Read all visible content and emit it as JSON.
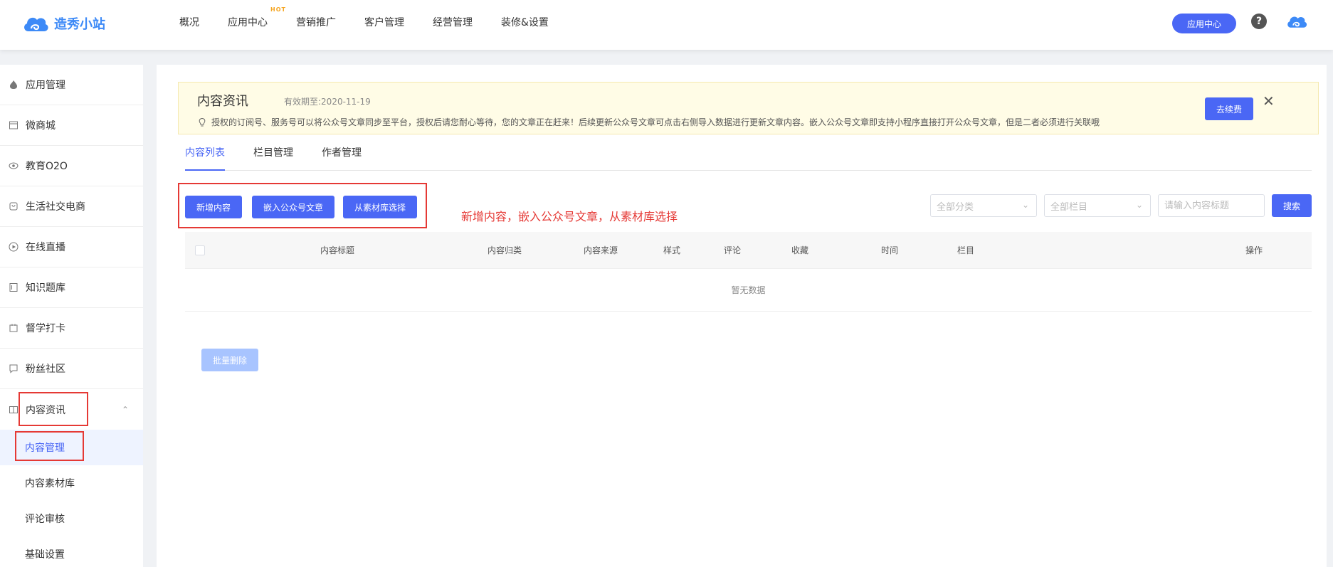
{
  "brand": {
    "name": "造秀小站",
    "color": "#3d8af7"
  },
  "nav": {
    "items": [
      "概况",
      "应用中心",
      "营销推广",
      "客户管理",
      "经营管理",
      "装修&设置"
    ],
    "hot_badge": "HOT",
    "app_center_button": "应用中心",
    "help": "?"
  },
  "sidebar": {
    "items": [
      {
        "label": "应用管理",
        "icon": "flame-icon"
      },
      {
        "label": "微商城",
        "icon": "store-icon"
      },
      {
        "label": "教育O2O",
        "icon": "eye-icon"
      },
      {
        "label": "生活社交电商",
        "icon": "bag-icon"
      },
      {
        "label": "在线直播",
        "icon": "play-icon"
      },
      {
        "label": "知识题库",
        "icon": "book-icon"
      },
      {
        "label": "督学打卡",
        "icon": "calendar-icon"
      },
      {
        "label": "粉丝社区",
        "icon": "chat-icon"
      },
      {
        "label": "内容资讯",
        "icon": "open-book-icon"
      }
    ],
    "subitems": [
      "内容管理",
      "内容素材库",
      "评论审核",
      "基础设置"
    ],
    "active_subitem": "内容管理"
  },
  "notice": {
    "title": "内容资讯",
    "expire": "有效期至:2020-11-19",
    "description": "授权的订阅号、服务号可以将公众号文章同步至平台，授权后请您耐心等待，您的文章正在赶来！后续更新公众号文章可点击右侧导入数据进行更新文章内容。嵌入公众号文章即支持小程序直接打开公众号文章，但是二者必须进行关联哦",
    "renew_button": "去续费"
  },
  "tabs": [
    "内容列表",
    "栏目管理",
    "作者管理"
  ],
  "actions": {
    "add": "新增内容",
    "embed": "嵌入公众号文章",
    "library": "从素材库选择",
    "annotation": "新增内容，嵌入公众号文章，从素材库选择"
  },
  "filters": {
    "category": "全部分类",
    "column": "全部栏目",
    "search_placeholder": "请输入内容标题",
    "search_button": "搜索"
  },
  "table": {
    "headers": [
      "内容标题",
      "内容归类",
      "内容来源",
      "样式",
      "评论",
      "收藏",
      "时间",
      "栏目",
      "操作"
    ],
    "empty": "暂无数据"
  },
  "batch_delete": "批量删除",
  "colors": {
    "accent": "#4a67f5",
    "annotation": "#e53935",
    "notice_bg": "#fffce6"
  }
}
